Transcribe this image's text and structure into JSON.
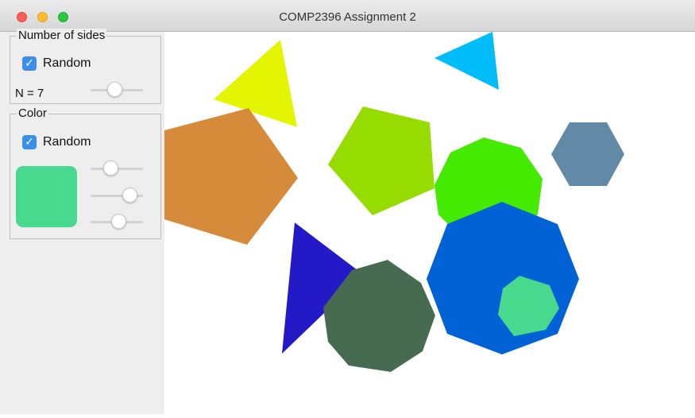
{
  "window": {
    "title": "COMP2396 Assignment 2"
  },
  "sides_group": {
    "title": "Number of sides",
    "random_label": "Random",
    "random_checked": true,
    "n_label": "N = 7",
    "slider_fraction": 0.45
  },
  "color_group": {
    "title": "Color",
    "random_label": "Random",
    "random_checked": true,
    "preview_color": "#48d98e",
    "slider_fractions": [
      0.35,
      0.85,
      0.55
    ]
  },
  "canvas": {
    "shapes": [
      {
        "name": "yellow-triangle-shape",
        "color": "#e3f500",
        "sides": 3
      },
      {
        "name": "cyan-triangle-shape",
        "color": "#00bdf9",
        "sides": 3
      },
      {
        "name": "orange-pentagon-shape",
        "color": "#d68b3b",
        "sides": 5
      },
      {
        "name": "lime-pentagon-shape",
        "color": "#97dc00",
        "sides": 5
      },
      {
        "name": "slate-hexagon-shape",
        "color": "#628aa6",
        "sides": 6
      },
      {
        "name": "green-octagon-shape",
        "color": "#44ea00",
        "sides": 8
      },
      {
        "name": "blue-octagon-shape",
        "color": "#0162d6",
        "sides": 8
      },
      {
        "name": "mint-heptagon-shape",
        "color": "#48d98e",
        "sides": 7
      },
      {
        "name": "indigo-triangle-shape",
        "color": "#2319c6",
        "sides": 3
      },
      {
        "name": "dark-green-nonagon-shape",
        "color": "#476b50",
        "sides": 9
      }
    ]
  }
}
